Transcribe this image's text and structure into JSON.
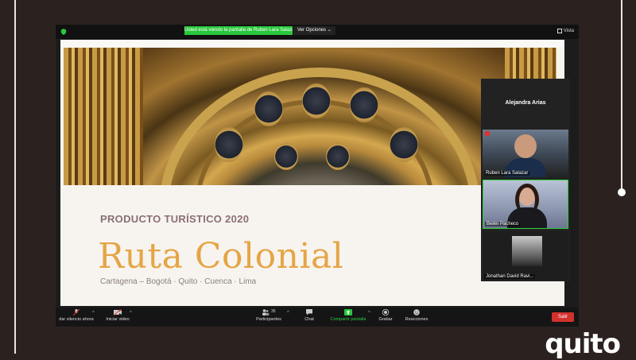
{
  "share_banner": "Usted está viendo la pantalla de Ruben Lara Salazar",
  "view_options": "Ver Opciones",
  "view_toggle": "Vista",
  "slide": {
    "kicker": "PRODUCTO TURÍSTICO 2020",
    "title": "Ruta Colonial",
    "subtitle": "Cartagena – Bogotá · Quito · Cuenca · Lima"
  },
  "participants": {
    "active_speaker": "Alejandra Arias",
    "tiles": [
      {
        "name": "Ruben Lara Salazar"
      },
      {
        "name": "Belén Pacheco"
      },
      {
        "name": "Jonathan David Ravi..."
      }
    ]
  },
  "toolbar": {
    "mute_label": "dar silencio ahora",
    "video_label": "Iniciar video",
    "participants_count": "35",
    "participants_label": "Participantes",
    "chat_label": "Chat",
    "share_label": "Compartir pantalla",
    "record_label": "Grabar",
    "reactions_label": "Reacciones",
    "leave_label": "Salir",
    "caret": "^"
  },
  "brand": "quito",
  "colors": {
    "accent_green": "#29c73c",
    "leave_red": "#d3312d",
    "title_gold": "#e5a545"
  }
}
